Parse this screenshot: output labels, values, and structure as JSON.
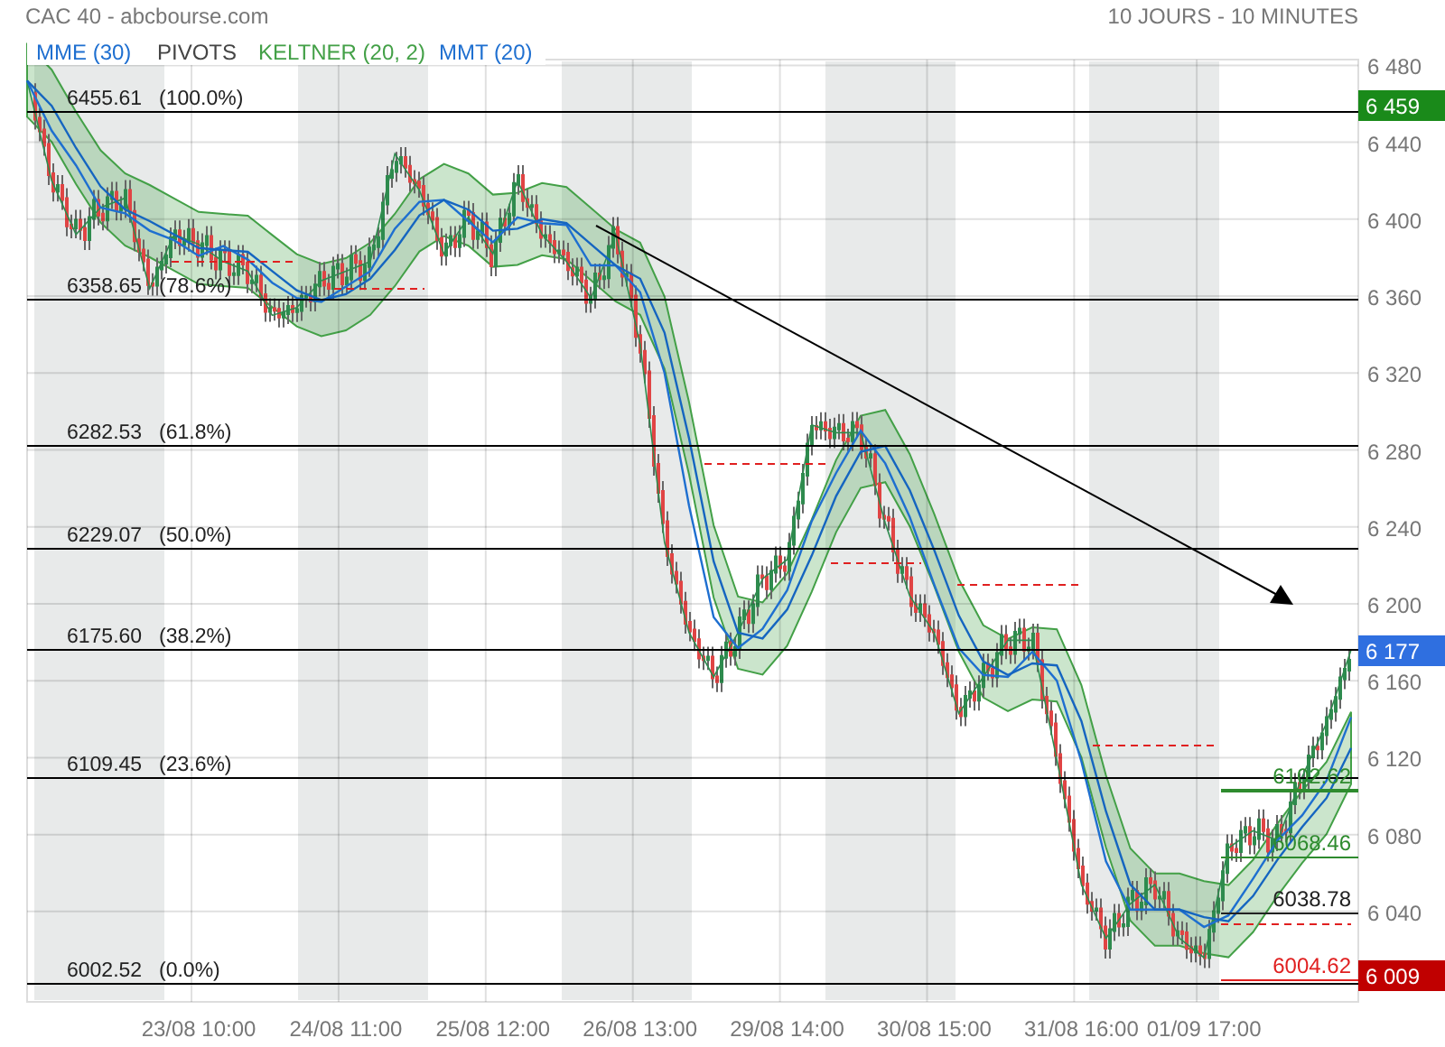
{
  "title": "CAC 40 - abcbourse.com",
  "period": "10 JOURS - 10 MINUTES",
  "legend": [
    {
      "label": "MME (30)",
      "color": "#1e6fd0"
    },
    {
      "label": "PIVOTS",
      "color": "#444444"
    },
    {
      "label": "KELTNER (20, 2)",
      "color": "#43a047"
    },
    {
      "label": "MMT (20)",
      "color": "#1e6fd0"
    }
  ],
  "chart_data": {
    "type": "line",
    "ylim": [
      5993,
      6483
    ],
    "grid": true,
    "categories": [
      null,
      null,
      null,
      null,
      null,
      null,
      null,
      "23/08 10:00",
      null,
      null,
      null,
      null,
      null,
      "24/08 11:00",
      null,
      null,
      null,
      null,
      null,
      "25/08 12:00",
      null,
      null,
      null,
      null,
      null,
      "26/08 13:00",
      null,
      null,
      null,
      null,
      null,
      "29/08 14:00",
      null,
      null,
      null,
      null,
      null,
      "30/08 15:00",
      null,
      null,
      null,
      null,
      null,
      "31/08 16:00",
      null,
      null,
      null,
      null,
      "01/09 17:00",
      null,
      null,
      null,
      null,
      null,
      null
    ],
    "series": [
      {
        "color": "#2e8b4e",
        "values": [
          6472,
          6420,
          6392,
          6406,
          6411,
          6364,
          6392,
          6387,
          6378,
          6373,
          6350,
          6354,
          6368,
          6373,
          6378,
          6434,
          6415,
          6382,
          6401,
          6382,
          6420,
          6392,
          6378,
          6359,
          6392,
          6335,
          6232,
          6185,
          6162,
          6185,
          6213,
          6223,
          6293,
          6289,
          6289,
          6242,
          6204,
          6185,
          6143,
          6162,
          6181,
          6181,
          6119,
          6054,
          6026,
          6044,
          6054,
          6026,
          6016,
          6073,
          6082,
          6077,
          6110,
          6138,
          6176
        ]
      },
      {
        "color": "#1e6fd0",
        "values": [
          6472,
          6446,
          6428,
          6406,
          6403,
          6394,
          6389,
          6381,
          6386,
          6379,
          6367,
          6359,
          6357,
          6365,
          6373,
          6395,
          6409,
          6410,
          6399,
          6388,
          6401,
          6398,
          6397,
          6376,
          6376,
          6362,
          6320,
          6251,
          6193,
          6177,
          6187,
          6207,
          6243,
          6268,
          6290,
          6273,
          6245,
          6210,
          6177,
          6163,
          6162,
          6175,
          6160,
          6118,
          6066,
          6041,
          6041,
          6041,
          6032,
          6038,
          6057,
          6077,
          6090,
          6108,
          6141
        ]
      },
      {
        "color": "#1565c0",
        "values": [
          6472,
          6459,
          6437,
          6417,
          6405,
          6399,
          6392,
          6385,
          6384,
          6383,
          6373,
          6363,
          6358,
          6361,
          6369,
          6384,
          6402,
          6410,
          6405,
          6394,
          6395,
          6400,
          6398,
          6387,
          6376,
          6369,
          6341,
          6286,
          6222,
          6185,
          6182,
          6197,
          6225,
          6256,
          6279,
          6282,
          6259,
          6228,
          6194,
          6170,
          6163,
          6169,
          6168,
          6139,
          6092,
          6054,
          6041,
          6041,
          6037,
          6035,
          6048,
          6067,
          6084,
          6099,
          6125
        ]
      }
    ],
    "yticks": [
      {
        "value": 6480,
        "label": "6 480"
      },
      {
        "value": 6440,
        "label": "6 440"
      },
      {
        "value": 6400,
        "label": "6 400"
      },
      {
        "value": 6360,
        "label": "6 360"
      },
      {
        "value": 6320,
        "label": "6 320"
      },
      {
        "value": 6280,
        "label": "6 280"
      },
      {
        "value": 6240,
        "label": "6 240"
      },
      {
        "value": 6200,
        "label": "6 200"
      },
      {
        "value": 6160,
        "label": "6 160"
      },
      {
        "value": 6120,
        "label": "6 120"
      },
      {
        "value": 6080,
        "label": "6 080"
      },
      {
        "value": 6040,
        "label": "6 040"
      }
    ]
  },
  "fib_levels": [
    {
      "value": "6455.61",
      "percent": "(100.0%)"
    },
    {
      "value": "6358.65",
      "percent": "(78.6%)"
    },
    {
      "value": "6282.53",
      "percent": "(61.8%)"
    },
    {
      "value": "6229.07",
      "percent": "(50.0%)"
    },
    {
      "value": "6175.60",
      "percent": "(38.2%)"
    },
    {
      "value": "6109.45",
      "percent": "(23.6%)"
    },
    {
      "value": "6002.52",
      "percent": "(0.0%)"
    }
  ],
  "pivot_labels": [
    {
      "label": "6102.62",
      "color": "#2e8b2e"
    },
    {
      "label": "6068.46",
      "color": "#2e8b2e"
    },
    {
      "label": "6038.78",
      "color": "#222222"
    },
    {
      "label": "6004.62",
      "color": "#e02020"
    }
  ],
  "price_tags": [
    {
      "label": "6 459",
      "color": "#1a8a1a"
    },
    {
      "label": "6 177",
      "color": "#2f6fe0"
    },
    {
      "label": "6 009",
      "color": "#c00000"
    }
  ]
}
